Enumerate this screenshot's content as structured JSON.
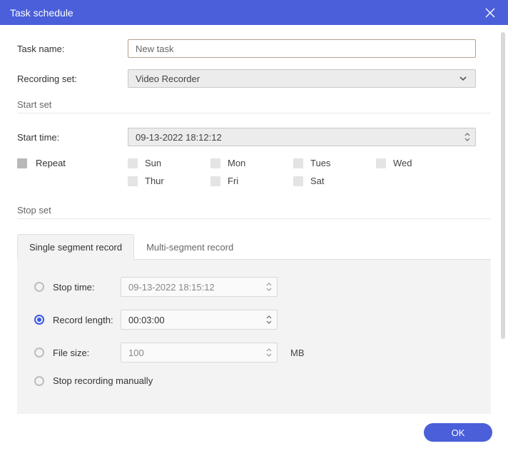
{
  "titlebar": {
    "title": "Task schedule"
  },
  "fields": {
    "task_name_label": "Task name:",
    "task_name_value": "New task",
    "recording_set_label": "Recording set:",
    "recording_set_value": "Video Recorder"
  },
  "start_set": {
    "section_label": "Start set",
    "start_time_label": "Start time:",
    "start_time_value": "09-13-2022 18:12:12",
    "repeat_label": "Repeat",
    "days": {
      "sun": "Sun",
      "mon": "Mon",
      "tues": "Tues",
      "wed": "Wed",
      "thur": "Thur",
      "fri": "Fri",
      "sat": "Sat"
    }
  },
  "stop_set": {
    "section_label": "Stop set",
    "tabs": {
      "single": "Single segment record",
      "multi": "Multi-segment record"
    },
    "stop_time_label": "Stop time:",
    "stop_time_value": "09-13-2022 18:15:12",
    "record_length_label": "Record length:",
    "record_length_value": "00:03:00",
    "file_size_label": "File size:",
    "file_size_value": "100",
    "file_size_unit": "MB",
    "stop_manual_label": "Stop recording manually",
    "selected": "record_length"
  },
  "footer": {
    "ok_label": "OK"
  }
}
